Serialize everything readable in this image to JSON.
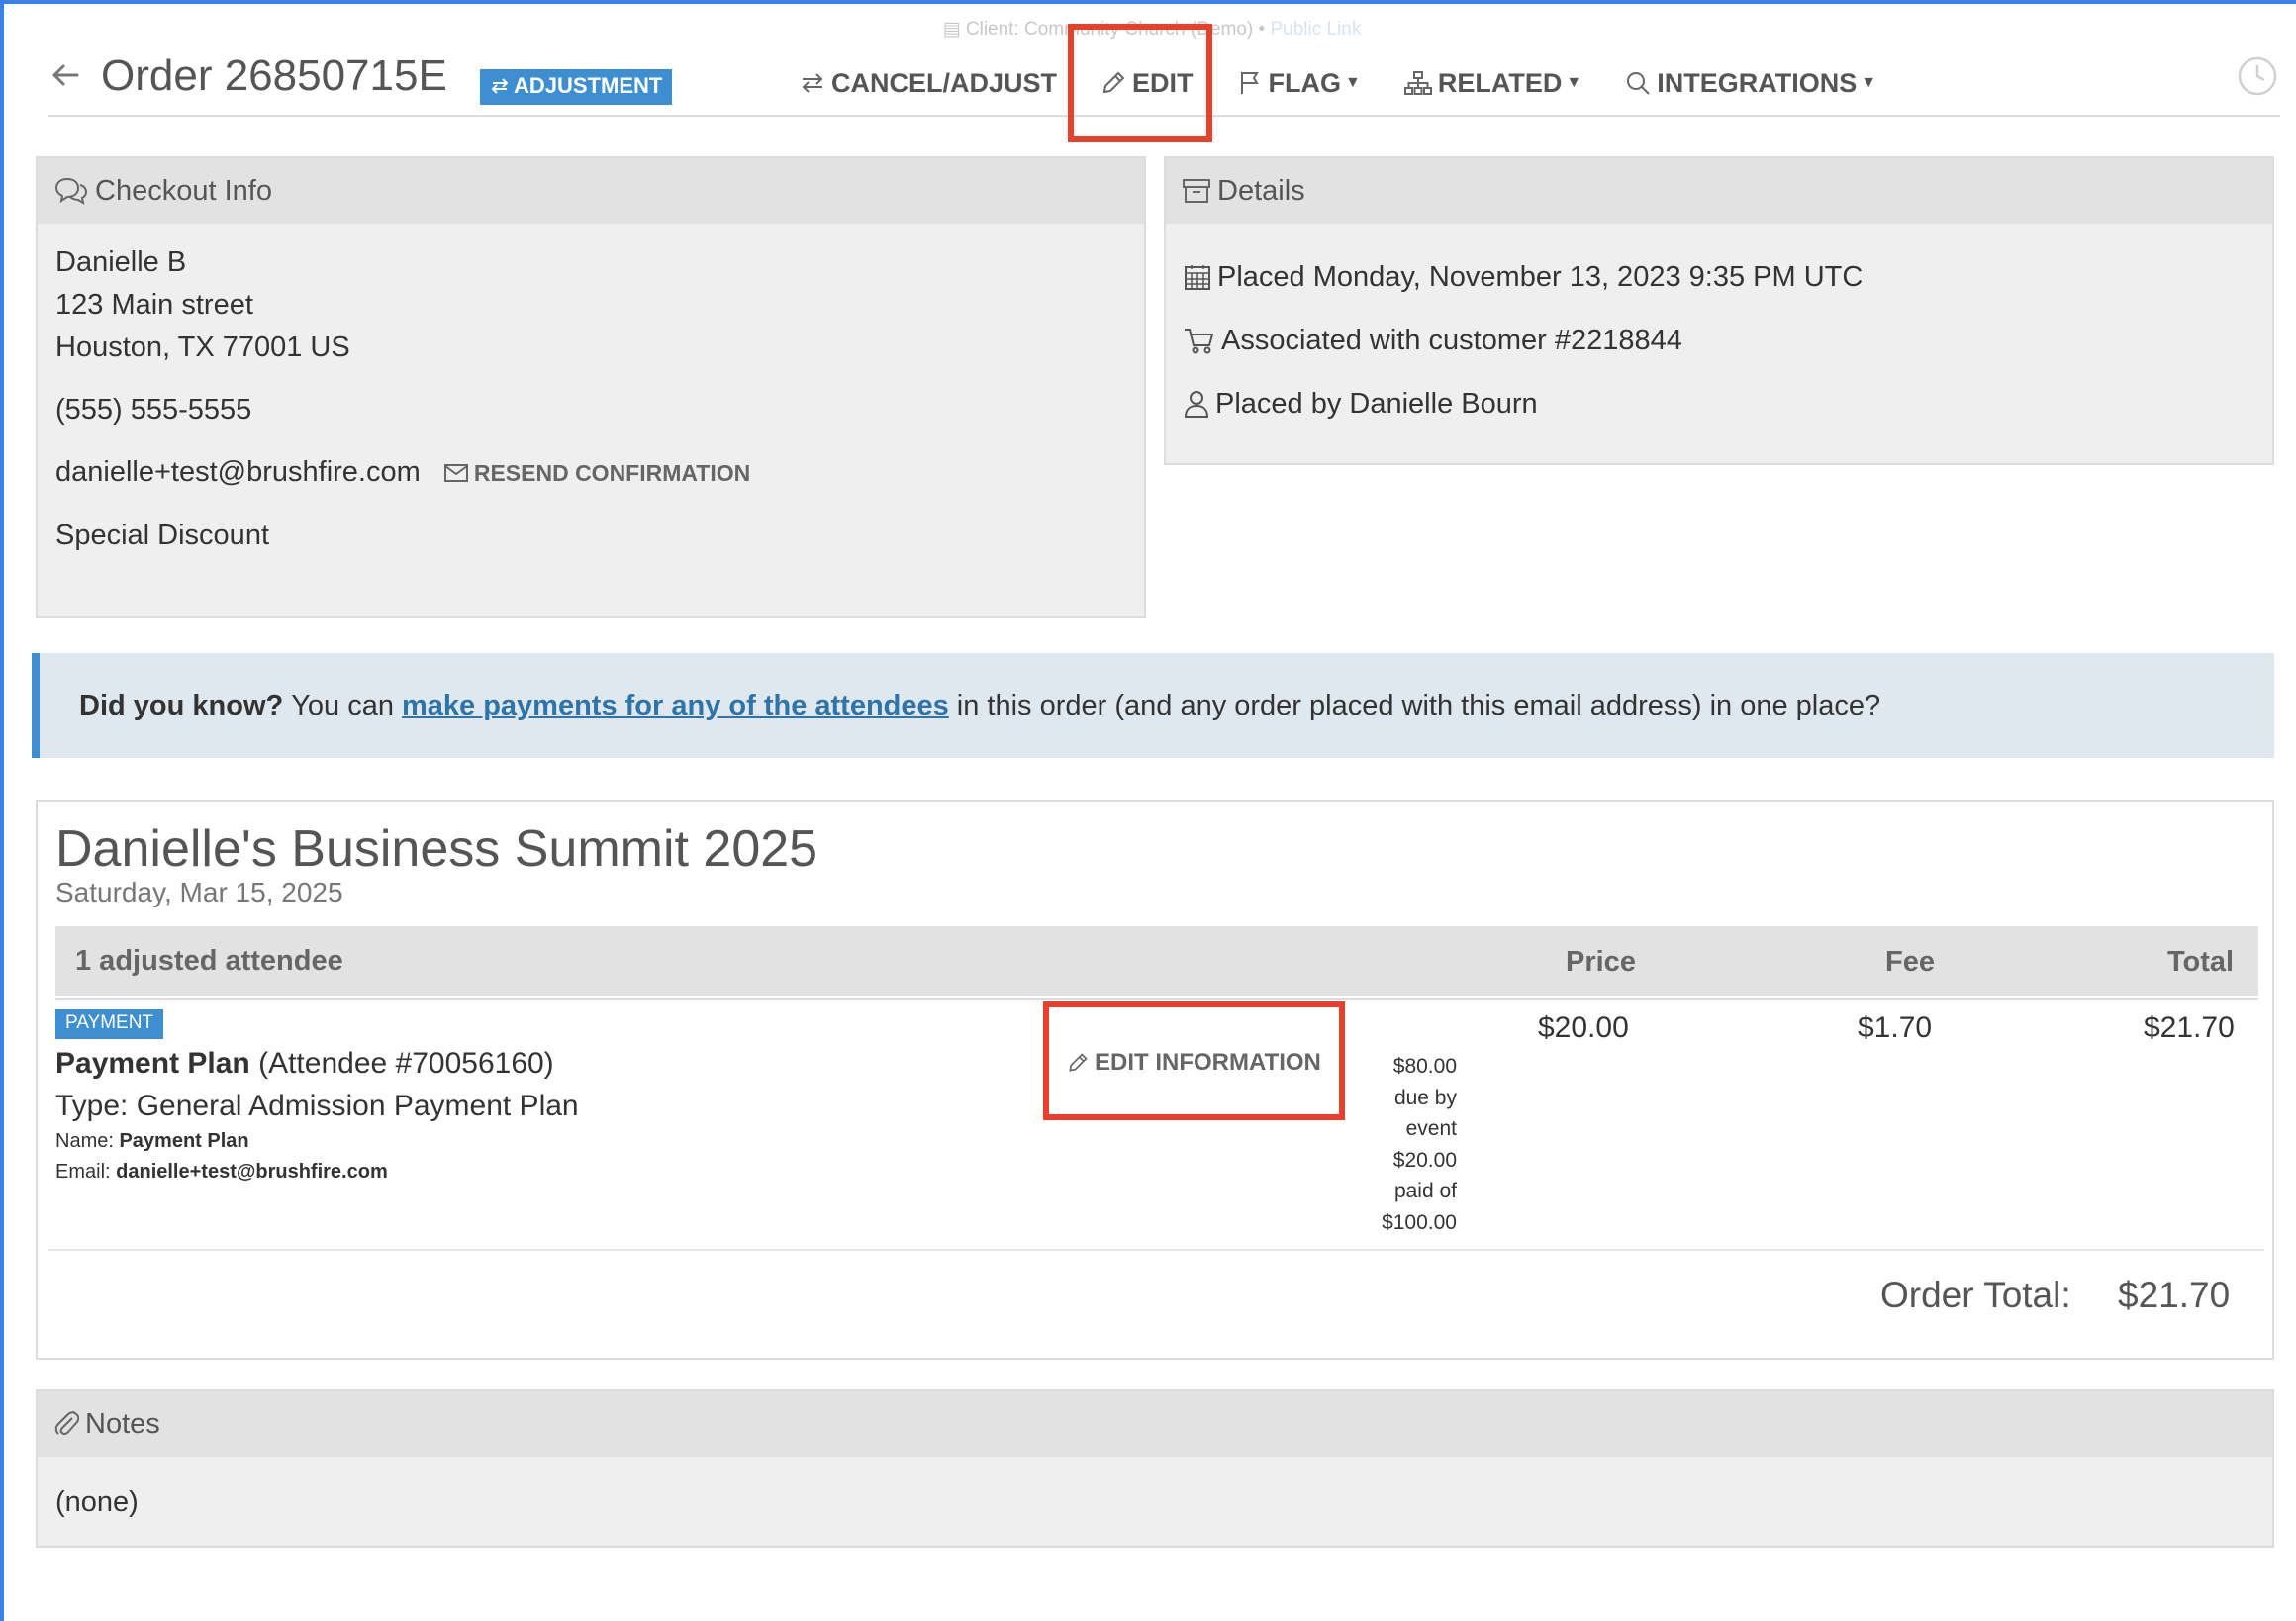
{
  "client_line": {
    "text": "Client: Community Church (Demo) •",
    "public_link": "Public Link"
  },
  "header": {
    "order_title": "Order 26850715E",
    "badge": "ADJUSTMENT",
    "nav": {
      "cancel_adjust": "CANCEL/ADJUST",
      "edit": "EDIT",
      "flag": "FLAG",
      "related": "RELATED",
      "integrations": "INTEGRATIONS"
    }
  },
  "checkout": {
    "title": "Checkout Info",
    "name": "Danielle B",
    "street": "123 Main street",
    "city": "Houston, TX 77001 US",
    "phone": "(555) 555-5555",
    "email": "danielle+test@brushfire.com",
    "resend": "RESEND CONFIRMATION",
    "discount": "Special Discount"
  },
  "details": {
    "title": "Details",
    "placed": "Placed Monday, November 13, 2023 9:35 PM UTC",
    "customer": "Associated with customer #2218844",
    "placed_by": "Placed by Danielle Bourn"
  },
  "callout": {
    "lead": "Did you know?",
    "pre": "You can",
    "link": "make payments for any of the attendees",
    "post": "in this order (and any order placed with this email address) in one place?"
  },
  "event": {
    "title": "Danielle's Business Summit 2025",
    "date": "Saturday, Mar 15, 2025",
    "attendee_header": "1 adjusted attendee",
    "columns": {
      "price": "Price",
      "fee": "Fee",
      "total": "Total"
    },
    "item": {
      "badge": "PAYMENT",
      "title": "Payment Plan",
      "attendee": "(Attendee #70056160)",
      "type": "Type: General Admission Payment Plan",
      "name_label": "Name:",
      "name_value": "Payment Plan",
      "email_label": "Email:",
      "email_value": "danielle+test@brushfire.com",
      "edit_info": "EDIT INFORMATION",
      "schedule": [
        "$80.00",
        "due by",
        "event",
        "$20.00",
        "paid of",
        "$100.00"
      ],
      "price": "$20.00",
      "fee": "$1.70",
      "total": "$21.70"
    },
    "order_total_label": "Order Total:",
    "order_total_value": "$21.70"
  },
  "notes": {
    "title": "Notes",
    "value": "(none)"
  },
  "colors": {
    "accent": "#3d8fd1",
    "highlight": "#e8412b",
    "link": "#2f74a8"
  }
}
